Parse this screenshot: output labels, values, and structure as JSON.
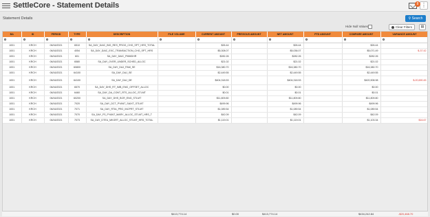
{
  "app": {
    "title": "SettleCore - Statement Details",
    "notification_count": "8"
  },
  "section": {
    "title": "Statement Details",
    "search_label": "Search"
  },
  "filters": {
    "hide_null_label": "Hide Null Values",
    "clear_filters_label": "Clear Filters"
  },
  "colors": {
    "header_bg": "#f08a3c",
    "accent": "#1e7ecb",
    "negative": "#d9342b"
  },
  "table": {
    "columns": [
      "BA",
      "ID",
      "PERIOD",
      "TYPE",
      "DESCRIPTION",
      "FILE VOLUME",
      "CURRENT AMOUNT",
      "PREVIOUS AMOUNT",
      "NET AMOUNT",
      "PTD AMOUNT",
      "COMPARE AMOUNT",
      "VARIANCE AMOUNT"
    ],
    "rows": [
      [
        "1001",
        "KRCH",
        "06/16/2021",
        "6510",
        "SA_DAY_DAIC_BIG_RES_PROG_CHG_SPT_HRS_TOTAL",
        "",
        "$26.44",
        "",
        "$26.44",
        "",
        "$26.44",
        ""
      ],
      [
        "1001",
        "KRCH",
        "06/16/2021",
        "4054",
        "SA_DAY_DAIC_EXC_TRANSACTION_CHG_SPT_HRS",
        "",
        "$5,308.07",
        "",
        "$5,036.07",
        "",
        "$5,071.49",
        "$-37.42"
      ],
      [
        "1001",
        "KRCH",
        "06/16/2021",
        "601",
        "SA_DAY_DAIC_PMMDHR",
        "",
        "$282.26",
        "",
        "$282.26",
        "",
        "$282.26",
        ""
      ],
      [
        "1001",
        "KRCH",
        "06/16/2021",
        "6580",
        "SA_DAY_OVER_UNDER_SCHED_ALLOC",
        "",
        "$21.02",
        "",
        "$21.02",
        "",
        "$21.02",
        ""
      ],
      [
        "1001",
        "KRCH",
        "06/16/2021",
        "60800",
        "SA_DAY_DAJ_PAM_SE",
        "",
        "$16,380.70",
        "",
        "$16,380.70",
        "",
        "$16,380.70",
        ""
      ],
      [
        "1001",
        "KRCH",
        "06/16/2021",
        "64100",
        "SA_DAY_DAJ_SE",
        "",
        "$2,449.55",
        "",
        "$2,449.55",
        "",
        "$2,449.55",
        ""
      ],
      [
        "1001",
        "KRCH",
        "06/16/2021",
        "64100",
        "SA_DAY_DAJ_DE",
        "",
        "$404,318.53",
        "",
        "$404,318.53",
        "",
        "$420,908.98",
        "$-20,690.45"
      ],
      [
        "1001",
        "KRCH",
        "06/16/2021",
        "6570",
        "SA_DAY_DHS_RT_IMB_ENG_OFFSET_ALLOC",
        "",
        "$0.00",
        "",
        "$0.00",
        "",
        "$0.00",
        ""
      ],
      [
        "1001",
        "KRCH",
        "06/16/2021",
        "6460",
        "SA_DAY_DA_CONT_RTS_ALLOC_STLMT",
        "",
        "$0.01",
        "",
        "$0.01",
        "",
        "$0.01",
        ""
      ],
      [
        "1001",
        "KRCH",
        "06/16/2021",
        "60200",
        "SA_DAY_DHS_BCR_ENG_STLMT",
        "",
        "$11,809.80",
        "",
        "$11,809.80",
        "",
        "$11,809.80",
        ""
      ],
      [
        "1001",
        "KRCH",
        "06/16/2021",
        "7020",
        "SA_DAY_DCT_PYANT_SAIXT_STLMT",
        "",
        "$499.96",
        "",
        "$499.96",
        "",
        "$499.96",
        ""
      ],
      [
        "1001",
        "KRCH",
        "06/16/2021",
        "7071",
        "SA_DAY_RTIA_PRO_INCPRT_STLMT",
        "",
        "$1,089.54",
        "",
        "$1,089.54",
        "",
        "$1,089.54",
        ""
      ],
      [
        "1001",
        "KRCH",
        "06/16/2021",
        "7070",
        "SA_DAY_FS_PYANT_MARY_ALLOC_STLMT_HRS_T",
        "",
        "$42.09",
        "",
        "$42.09",
        "",
        "$42.09",
        ""
      ],
      [
        "1001",
        "KRCH",
        "06/16/2021",
        "7073",
        "SA_DAY_DTEU_MKGRT_ALLOC_STLMT_HRS_TOTAL",
        "",
        "$1,119.01",
        "",
        "$1,119.01",
        "",
        "$1,103.34",
        "$16.67"
      ]
    ],
    "totals": {
      "current_amount": "$413,774.14",
      "previous_amount": "$0.00",
      "net_amount": "$413,774.14",
      "compare_amount": "$434,242.84",
      "variance_amount": "-$20,468.70"
    }
  }
}
